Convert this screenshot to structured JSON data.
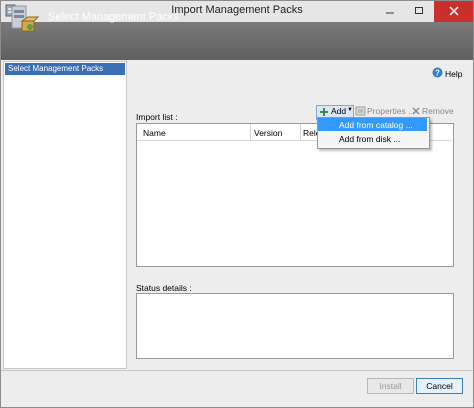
{
  "window": {
    "title": "Import Management Packs"
  },
  "header": {
    "title": "Select Management Packs"
  },
  "nav": {
    "items": [
      "Select Management Packs"
    ]
  },
  "help": {
    "label": "Help"
  },
  "import": {
    "label": "Import list :",
    "toolbar": {
      "add": "Add",
      "properties": "Properties ...",
      "remove": "Remove"
    },
    "columns": [
      "Name",
      "Version",
      "Rele"
    ]
  },
  "menu": {
    "items": [
      "Add from catalog ...",
      "Add from disk ..."
    ]
  },
  "status": {
    "label": "Status details :"
  },
  "buttons": {
    "install": "Install",
    "cancel": "Cancel"
  },
  "colors": {
    "accent": "#3399ff",
    "nav_selected": "#3a6fb5",
    "close": "#c9302c"
  }
}
